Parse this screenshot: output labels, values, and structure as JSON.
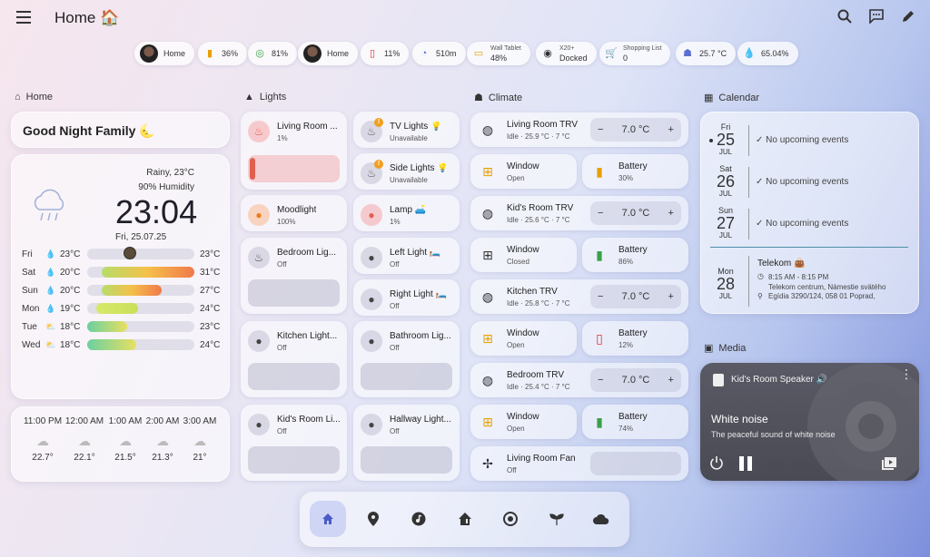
{
  "header": {
    "title": "Home 🏠"
  },
  "chips": [
    {
      "label": "Home",
      "icon": "avatar"
    },
    {
      "label": "36%",
      "icon": "battery-icon",
      "color": "#e8a000"
    },
    {
      "label": "81%",
      "icon": "watch-icon",
      "color": "#3aa048"
    },
    {
      "label": "Home",
      "icon": "avatar"
    },
    {
      "label": "11%",
      "icon": "phone-battery-icon",
      "color": "#e03030"
    },
    {
      "label": "510m",
      "icon": "distance-icon",
      "color": "#5a70d0"
    },
    {
      "label": "Wall Tablet",
      "sub": "48%",
      "icon": "tablet-icon",
      "color": "#e8a000"
    },
    {
      "label": "X20+",
      "sub": "Docked",
      "icon": "vacuum-icon",
      "color": "#333"
    },
    {
      "label": "Shopping List",
      "sub": "0",
      "icon": "cart-icon",
      "color": "#5a70d0"
    },
    {
      "label": "25.7 °C",
      "icon": "thermometer-home-icon",
      "color": "#5a70d0"
    },
    {
      "label": "65.04%",
      "icon": "humidity-icon",
      "color": "#5a70d0"
    }
  ],
  "sections": {
    "home": "Home",
    "lights": "Lights",
    "climate": "Climate",
    "calendar": "Calendar",
    "media": "Media"
  },
  "greeting": "Good Night Family 🌜",
  "weather": {
    "condition": "Rainy, 23°C",
    "humidity": "90% Humidity",
    "time": "23:04",
    "date": "Fri, 25.07.25",
    "forecast": [
      {
        "day": "Fri",
        "low": "23°C",
        "high": "23°C",
        "icon": "rain-icon"
      },
      {
        "day": "Sat",
        "low": "20°C",
        "high": "31°C",
        "icon": "rain-icon"
      },
      {
        "day": "Sun",
        "low": "20°C",
        "high": "27°C",
        "icon": "rain-icon"
      },
      {
        "day": "Mon",
        "low": "19°C",
        "high": "24°C",
        "icon": "rain-icon"
      },
      {
        "day": "Tue",
        "low": "18°C",
        "high": "23°C",
        "icon": "partly-cloudy-icon"
      },
      {
        "day": "Wed",
        "low": "18°C",
        "high": "24°C",
        "icon": "partly-cloudy-icon"
      }
    ],
    "hourly": [
      {
        "time": "11:00 PM",
        "temp": "22.7°"
      },
      {
        "time": "12:00 AM",
        "temp": "22.1°"
      },
      {
        "time": "1:00 AM",
        "temp": "21.5°"
      },
      {
        "time": "2:00 AM",
        "temp": "21.3°"
      },
      {
        "time": "3:00 AM",
        "temp": "21°"
      }
    ]
  },
  "lights": [
    {
      "name": "Living Room ...",
      "state": "1%"
    },
    {
      "name": "TV Lights 💡",
      "state": "Unavailable"
    },
    {
      "name": "Side Lights 💡",
      "state": "Unavailable"
    },
    {
      "name": "Moodlight",
      "state": "100%"
    },
    {
      "name": "Lamp 🛋️",
      "state": "1%"
    },
    {
      "name": "Bedroom Lig...",
      "state": "Off"
    },
    {
      "name": "Left Light 🛏️",
      "state": "Off"
    },
    {
      "name": "Right Light 🛏️",
      "state": "Off"
    },
    {
      "name": "Kitchen Light...",
      "state": "Off"
    },
    {
      "name": "Bathroom Lig...",
      "state": "Off"
    },
    {
      "name": "Kid's Room Li...",
      "state": "Off"
    },
    {
      "name": "Hallway Light...",
      "state": "Off"
    }
  ],
  "climate": {
    "trvs": [
      {
        "name": "Living Room TRV",
        "state": "Idle · 25.9 °C · 7 °C",
        "setpoint": "7.0 °C"
      },
      {
        "name": "Kid's Room TRV",
        "state": "Idle · 25.6 °C · 7 °C",
        "setpoint": "7.0 °C"
      },
      {
        "name": "Kitchen TRV",
        "state": "Idle · 25.8 °C · 7 °C",
        "setpoint": "7.0 °C"
      },
      {
        "name": "Bedroom TRV",
        "state": "Idle · 25.4 °C · 7 °C",
        "setpoint": "7.0 °C"
      }
    ],
    "windows": [
      {
        "name": "Window",
        "state": "Open"
      },
      {
        "name": "Window",
        "state": "Closed"
      },
      {
        "name": "Window",
        "state": "Open"
      },
      {
        "name": "Window",
        "state": "Open"
      }
    ],
    "batteries": [
      {
        "name": "Battery",
        "state": "30%",
        "color": "#e8a000"
      },
      {
        "name": "Battery",
        "state": "86%",
        "color": "#3aa048"
      },
      {
        "name": "Battery",
        "state": "12%",
        "color": "#e03030"
      },
      {
        "name": "Battery",
        "state": "74%",
        "color": "#3aa048"
      }
    ],
    "fan": {
      "name": "Living Room Fan",
      "state": "Off"
    },
    "minus": "−",
    "plus": "+"
  },
  "calendar": {
    "days": [
      {
        "name": "Fri",
        "num": "25",
        "month": "JUL",
        "event": "✓ No upcoming events"
      },
      {
        "name": "Sat",
        "num": "26",
        "month": "JUL",
        "event": "✓ No upcoming events"
      },
      {
        "name": "Sun",
        "num": "27",
        "month": "JUL",
        "event": "✓ No upcoming events"
      },
      {
        "name": "Mon",
        "num": "28",
        "month": "JUL"
      }
    ],
    "event": {
      "title": "Telekom 👜",
      "time": "8:15 AM - 8:15 PM",
      "location": "Telekom centrum, Námestie svätého Egídia 3290/124, 058 01 Poprad,"
    }
  },
  "media": {
    "player": "Kid's Room Speaker 🔊",
    "title": "White noise",
    "subtitle": "The peaceful sound of white noise"
  }
}
